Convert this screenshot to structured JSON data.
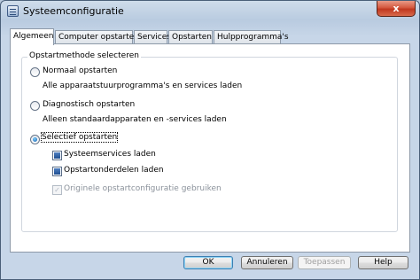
{
  "window": {
    "title": "Systeemconfiguratie",
    "close_symbol": "x"
  },
  "tabs": [
    {
      "label": "Algemeen",
      "active": true
    },
    {
      "label": "Computer opstarten",
      "active": false
    },
    {
      "label": "Services",
      "active": false
    },
    {
      "label": "Opstarten",
      "active": false
    },
    {
      "label": "Hulpprogramma's",
      "active": false
    }
  ],
  "startup": {
    "group_label": "Opstartmethode selecteren",
    "options": [
      {
        "label": "Normaal opstarten",
        "description": "Alle apparaatstuurprogramma's en services laden",
        "selected": false
      },
      {
        "label": "Diagnostisch opstarten",
        "description": "Alleen standaardapparaten en -services laden",
        "selected": false
      },
      {
        "label": "Selectief opstarten",
        "selected": true
      }
    ],
    "selective_items": [
      {
        "label": "Systeemservices laden",
        "checked": true,
        "enabled": true
      },
      {
        "label": "Opstartonderdelen laden",
        "checked": true,
        "enabled": true
      },
      {
        "label": "Originele opstartconfiguratie gebruiken",
        "checked": true,
        "enabled": false
      }
    ]
  },
  "buttons": {
    "ok": "OK",
    "cancel": "Annuleren",
    "apply": "Toepassen",
    "help": "Help"
  }
}
